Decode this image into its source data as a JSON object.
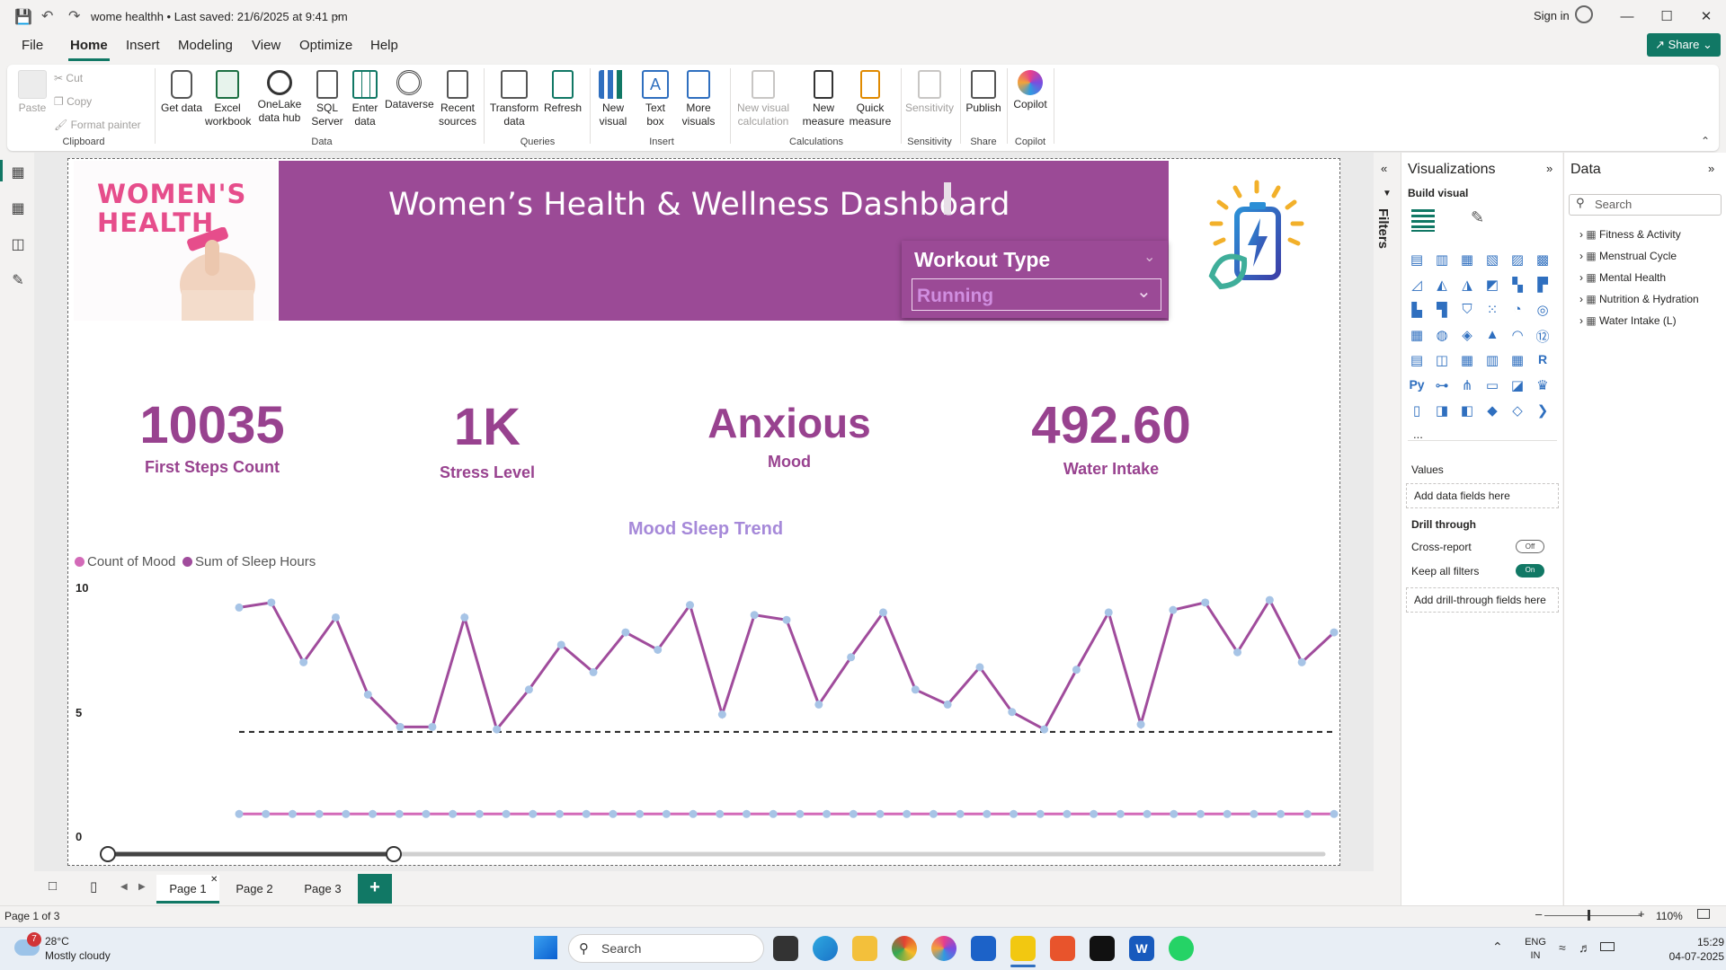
{
  "titlebar": {
    "doc_title": "wome healthh • Last saved: 21/6/2025 at 9:41 pm",
    "sign_in": "Sign in"
  },
  "menu": [
    "File",
    "Home",
    "Insert",
    "Modeling",
    "View",
    "Optimize",
    "Help"
  ],
  "share_label": "Share",
  "ribbon": {
    "clipboard": {
      "paste": "Paste",
      "cut": "Cut",
      "copy": "Copy",
      "format_painter": "Format painter",
      "group": "Clipboard"
    },
    "data": {
      "items": [
        "Get data",
        "Excel workbook",
        "OneLake data hub",
        "SQL Server",
        "Enter data",
        "Dataverse",
        "Recent sources"
      ],
      "group": "Data"
    },
    "queries": {
      "items": [
        "Transform data",
        "Refresh"
      ],
      "group": "Queries"
    },
    "insert": {
      "items": [
        "New visual",
        "Text box",
        "More visuals"
      ],
      "group": "Insert"
    },
    "calculations": {
      "items": [
        "New visual calculation",
        "New measure",
        "Quick measure"
      ],
      "group": "Calculations"
    },
    "sensitivity": {
      "items": [
        "Sensitivity"
      ],
      "group": "Sensitivity"
    },
    "share": {
      "items": [
        "Publish"
      ],
      "group": "Share"
    },
    "copilot": {
      "items": [
        "Copilot"
      ],
      "group": "Copilot"
    }
  },
  "report": {
    "logo_line1": "WOMEN'S",
    "logo_line2": "HEALTH",
    "title": "Women’s Health & Wellness Dashboard",
    "slicer": {
      "title": "Workout Type",
      "value": "Running"
    },
    "kpis": [
      {
        "value": "10035",
        "label": "First Steps Count"
      },
      {
        "value": "1K",
        "label": "Stress Level"
      },
      {
        "value": "Anxious",
        "label": "Mood"
      },
      {
        "value": "492.60",
        "label": "Water Intake"
      }
    ]
  },
  "chart_data": {
    "type": "line",
    "title": "Mood Sleep Trend",
    "ylim": [
      0,
      10
    ],
    "y_ticks": [
      "10",
      "5",
      "0"
    ],
    "series": [
      {
        "name": "Count of Mood",
        "color": "#d36ab8",
        "values": [
          1,
          1,
          1,
          1,
          1,
          1,
          1,
          1,
          1,
          1,
          1,
          1,
          1,
          1,
          1,
          1,
          1,
          1,
          1,
          1,
          1,
          1,
          1,
          1,
          1,
          1,
          1,
          1,
          1,
          1,
          1,
          1,
          1,
          1,
          1,
          1,
          1,
          1,
          1,
          1,
          1,
          1
        ]
      },
      {
        "name": "Sum of Sleep Hours",
        "color": "#a04c9c",
        "values": [
          9.3,
          9.5,
          7.1,
          8.9,
          5.8,
          4.5,
          4.5,
          8.9,
          4.4,
          6.0,
          7.8,
          6.7,
          8.3,
          7.6,
          9.4,
          5.0,
          9.0,
          8.8,
          5.4,
          7.3,
          9.1,
          6.0,
          5.4,
          6.9,
          5.1,
          4.4,
          6.8,
          9.1,
          4.6,
          9.2,
          9.5,
          7.5,
          9.6,
          7.1,
          8.3
        ]
      }
    ],
    "reference_line": 4.3,
    "legend": "top-left",
    "grid": false
  },
  "pages": [
    "Page 1",
    "Page 2",
    "Page 3"
  ],
  "status": {
    "page": "Page 1 of 3",
    "zoom": "110%"
  },
  "filters_label": "Filters",
  "visualizations": {
    "title": "Visualizations",
    "build_visual": "Build visual",
    "values_label": "Values",
    "add_data_fields": "Add data fields here",
    "drill_through": "Drill through",
    "cross_report": "Cross-report",
    "cross_report_state": "Off",
    "keep_all_filters": "Keep all filters",
    "keep_all_filters_state": "On",
    "add_drill_fields": "Add drill-through fields here",
    "more": "..."
  },
  "data_pane": {
    "title": "Data",
    "search_placeholder": "Search",
    "tables": [
      "Fitness & Activity",
      "Menstrual Cycle",
      "Mental Health",
      "Nutrition & Hydration",
      "Water Intake (L)"
    ]
  },
  "taskbar": {
    "weather_temp": "28°C",
    "weather_desc": "Mostly cloudy",
    "weather_badge": "7",
    "search_label": "Search",
    "lang1": "ENG",
    "lang2": "IN",
    "time": "15:29",
    "date": "04-07-2025"
  }
}
